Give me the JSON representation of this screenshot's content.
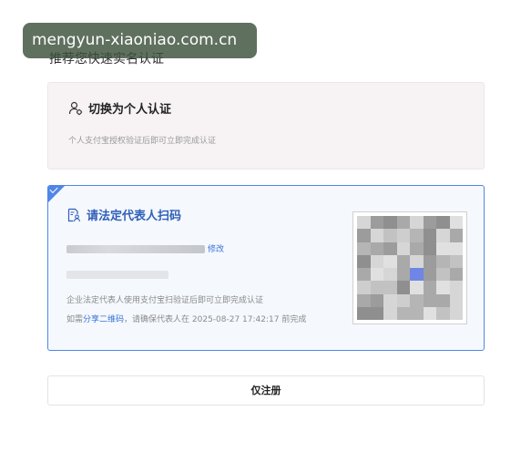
{
  "watermark": {
    "text": "mengyun-xiaoniao.com.cn"
  },
  "heading": "推荐您快速实名认证",
  "personal_card": {
    "title": "切换为个人认证",
    "description": "个人支付宝授权验证后即可立即完成认证",
    "icon": "person-settings-icon"
  },
  "legal_card": {
    "title": "请法定代表人扫码",
    "icon": "document-person-icon",
    "edit_label": "修改",
    "description": "企业法定代表人使用支付宝扫验证后即可立即完成认证",
    "note_prefix": "如需",
    "note_share": "分享二维码",
    "note_suffix": "，请确保代表人在 2025-08-27 17:42:17 前完成",
    "selected": true,
    "accent": "#4f86e8"
  },
  "register_button": {
    "label": "仅注册"
  },
  "colors": {
    "accent": "#4f86e8",
    "link": "#3a73d8",
    "muted_text": "#9a9a9a"
  }
}
